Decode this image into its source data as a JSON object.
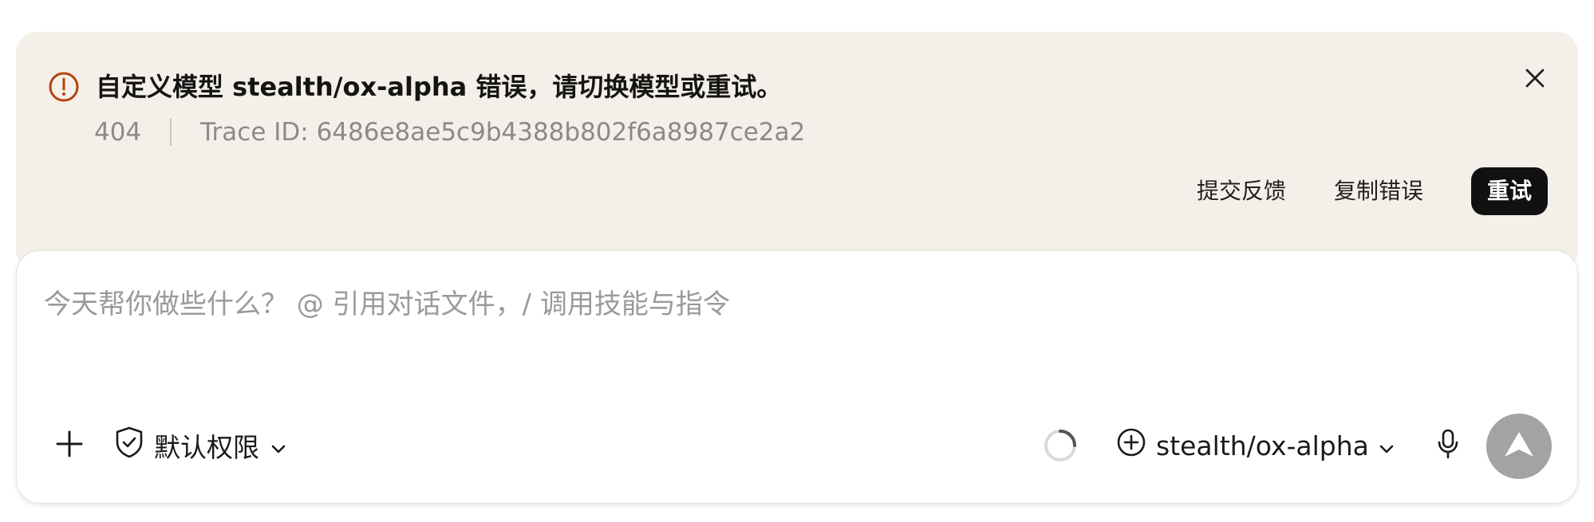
{
  "error": {
    "icon": "alert-circle-icon",
    "title": "自定义模型 stealth/ox-alpha 错误，请切换模型或重试。",
    "status_code": "404",
    "trace": "Trace ID: 6486e8ae5c9b4388b802f6a8987ce2a2",
    "actions": {
      "feedback": "提交反馈",
      "copy": "复制错误",
      "retry": "重试"
    },
    "accent_color": "#b5410f",
    "background_color": "#f4f0e9"
  },
  "composer": {
    "placeholder": "今天帮你做些什么？ @ 引用对话文件，/ 调用技能与指令",
    "permission_label": "默认权限",
    "model_label": "stealth/ox-alpha",
    "icons": {
      "add": "plus-icon",
      "permission": "shield-check-icon",
      "status": "loading-spinner-icon",
      "model": "plus-circle-icon",
      "mic": "microphone-icon",
      "send": "send-arrow-icon"
    },
    "send_button_color": "#a3a3a3"
  }
}
